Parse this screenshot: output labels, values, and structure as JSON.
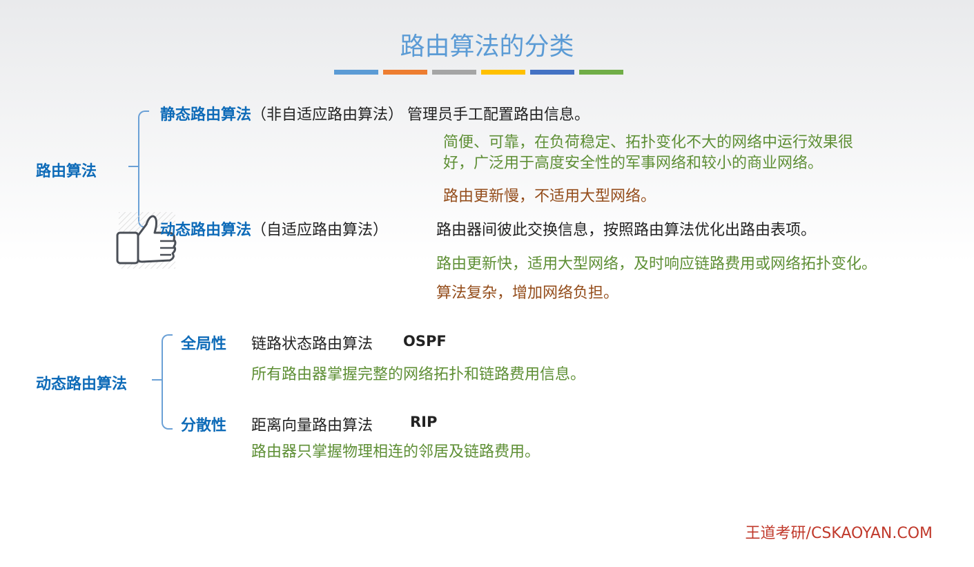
{
  "title": "路由算法的分类",
  "accent_colors": [
    "#5b9bd5",
    "#ed7d31",
    "#a5a5a5",
    "#ffc000",
    "#4472c4",
    "#70ad47"
  ],
  "section1": {
    "root": "路由算法",
    "static": {
      "label": "静态路由算法",
      "paren": "（非自适应路由算法）",
      "desc": "管理员手工配置路由信息。",
      "pro_line1": "简便、可靠，在负荷稳定、拓扑变化不大的网络中运行效果很",
      "pro_line2": "好，广泛用于高度安全性的军事网络和较小的商业网络。",
      "con": "路由更新慢，不适用大型网络。"
    },
    "dynamic": {
      "label": "动态路由算法",
      "paren": "（自适应路由算法）",
      "desc": "路由器间彼此交换信息，按照路由算法优化出路由表项。",
      "pro": "路由更新快，适用大型网络，及时响应链路费用或网络拓扑变化。",
      "con": "算法复杂，增加网络负担。"
    },
    "thumb_icon": "thumbs-up-icon"
  },
  "section2": {
    "root": "动态路由算法",
    "global": {
      "label": "全局性",
      "algo": "链路状态路由算法",
      "protocol": "OSPF",
      "desc": "所有路由器掌握完整的网络拓扑和链路费用信息。"
    },
    "distributed": {
      "label": "分散性",
      "algo": "距离向量路由算法",
      "protocol": "RIP",
      "desc": "路由器只掌握物理相连的邻居及链路费用。"
    }
  },
  "footer": "王道考研/CSKAOYAN.COM"
}
